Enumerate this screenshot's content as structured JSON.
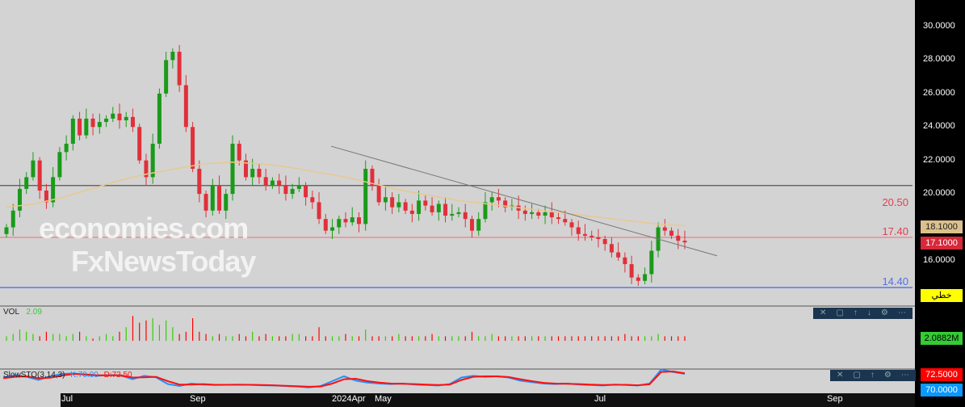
{
  "watermark": {
    "line1": "economies.com",
    "line2": "FxNewsToday"
  },
  "price_axis": {
    "labels": [
      "30.0000",
      "28.0000",
      "26.0000",
      "24.0000",
      "22.0000",
      "20.0000",
      "18.0000",
      "16.0000"
    ],
    "ma_value": "18.1000",
    "last_price": "17.1000",
    "mode_label": "خطي"
  },
  "levels": [
    {
      "label": "20.50",
      "value": 20.5,
      "color": "#555555",
      "text_color": "#e04050"
    },
    {
      "label": "17.40",
      "value": 17.4,
      "color": "#e88890",
      "text_color": "#e04050"
    },
    {
      "label": "14.40",
      "value": 14.4,
      "color": "#5070e8",
      "text_color": "#5070e8"
    }
  ],
  "volume": {
    "title": "VOL",
    "value": "2.09",
    "axis_value": "2.0882M"
  },
  "sto": {
    "title": "SlowSTO(3,14,3)",
    "k": "K:70.00",
    "d": "D:72.50",
    "d_axis": "72.5000",
    "k_axis": "70.0000"
  },
  "x_labels": [
    "Jul",
    "Sep",
    "2024Apr",
    "May",
    "Jul",
    "Sep"
  ],
  "chart_data": {
    "type": "candlestick",
    "closes": [
      18,
      19,
      20.3,
      21,
      22,
      20.2,
      19.5,
      21,
      22.5,
      23,
      24.5,
      23.5,
      24.5,
      24,
      24.3,
      24.5,
      24.8,
      24.4,
      24.6,
      24,
      22,
      21,
      23,
      26,
      28,
      28.5,
      26.5,
      24,
      21.5,
      20,
      19,
      20.5,
      19,
      20,
      23,
      22,
      21,
      21.5,
      21,
      20.5,
      20.8,
      20.5,
      20,
      20.3,
      20.5,
      19.8,
      19.5,
      18.5,
      17.8,
      18,
      18.5,
      18.3,
      18.6,
      18.2,
      21.5,
      20.5,
      19.5,
      19.8,
      19.2,
      19.5,
      19,
      18.8,
      19.6,
      19.3,
      18.9,
      19.4,
      18.7,
      18.8,
      18.9,
      18.5,
      17.8,
      18.5,
      19.5,
      19.8,
      19.6,
      19.2,
      19.3,
      19,
      18.8,
      18.9,
      18.7,
      18.9,
      18.6,
      18.5,
      18.3,
      18,
      17.6,
      17.5,
      17.4,
      17.3,
      17,
      16.5,
      16.2,
      15.8,
      15,
      14.8,
      15.2,
      16.6,
      18,
      17.8,
      17.5,
      17.2,
      17.1
    ],
    "ma": [
      19.2,
      19.4,
      19.8,
      20.3,
      20.8,
      21.2,
      21.5,
      21.8,
      21.9,
      21.8,
      21.6,
      21.3,
      21.0,
      20.6,
      20.2,
      19.9,
      19.6,
      19.4,
      19.2,
      19.0,
      18.8,
      18.6,
      18.4,
      18.2,
      18.1
    ],
    "volume": [
      2,
      3,
      5,
      4,
      3,
      2,
      4,
      3,
      3,
      2,
      3,
      4,
      2,
      1,
      2,
      3,
      2,
      4,
      6,
      11,
      8,
      9,
      10,
      7,
      9,
      6,
      3,
      4,
      10,
      4,
      3,
      2,
      3,
      2,
      2,
      3,
      2,
      4,
      2,
      3,
      2,
      2,
      2,
      3,
      3,
      2,
      2,
      6,
      2,
      2,
      2,
      3,
      2,
      2,
      5,
      2,
      2,
      2,
      2,
      3,
      2,
      2,
      2,
      2,
      3,
      2,
      2,
      2,
      2,
      2,
      4,
      2,
      2,
      3,
      2,
      2,
      2,
      2,
      2,
      2,
      2,
      2,
      2,
      2,
      2,
      2,
      2,
      2,
      2,
      2,
      2,
      2,
      2,
      3,
      2,
      2,
      2,
      2,
      3,
      2,
      2,
      2,
      2
    ],
    "sto_k": [
      55,
      65,
      58,
      45,
      60,
      70,
      72,
      66,
      62,
      65,
      64,
      48,
      62,
      56,
      28,
      20,
      30,
      26,
      24,
      25,
      26,
      25,
      23,
      22,
      20,
      18,
      14,
      20,
      40,
      60,
      42,
      34,
      30,
      28,
      30,
      26,
      24,
      22,
      28,
      55,
      62,
      58,
      60,
      55,
      42,
      36,
      30,
      28,
      30,
      26,
      24,
      22,
      26,
      24,
      22,
      30,
      88,
      78,
      70
    ],
    "sto_d": [
      52,
      58,
      60,
      52,
      54,
      63,
      70,
      68,
      64,
      64,
      64,
      55,
      56,
      58,
      40,
      26,
      26,
      28,
      25,
      25,
      25,
      25,
      24,
      23,
      21,
      19,
      17,
      18,
      30,
      48,
      50,
      40,
      34,
      30,
      29,
      28,
      26,
      24,
      26,
      45,
      58,
      60,
      60,
      57,
      48,
      40,
      33,
      30,
      29,
      28,
      26,
      24,
      25,
      25,
      23,
      27,
      78,
      80,
      72.5
    ],
    "ylim": [
      14,
      31
    ],
    "trendline": {
      "from": 22.85,
      "to": 16.3
    }
  },
  "colors": {
    "up": "#1a9a1a",
    "down": "#e0303a",
    "ma": "#e8c890",
    "k": "#2090ff",
    "d": "#ff1010"
  }
}
